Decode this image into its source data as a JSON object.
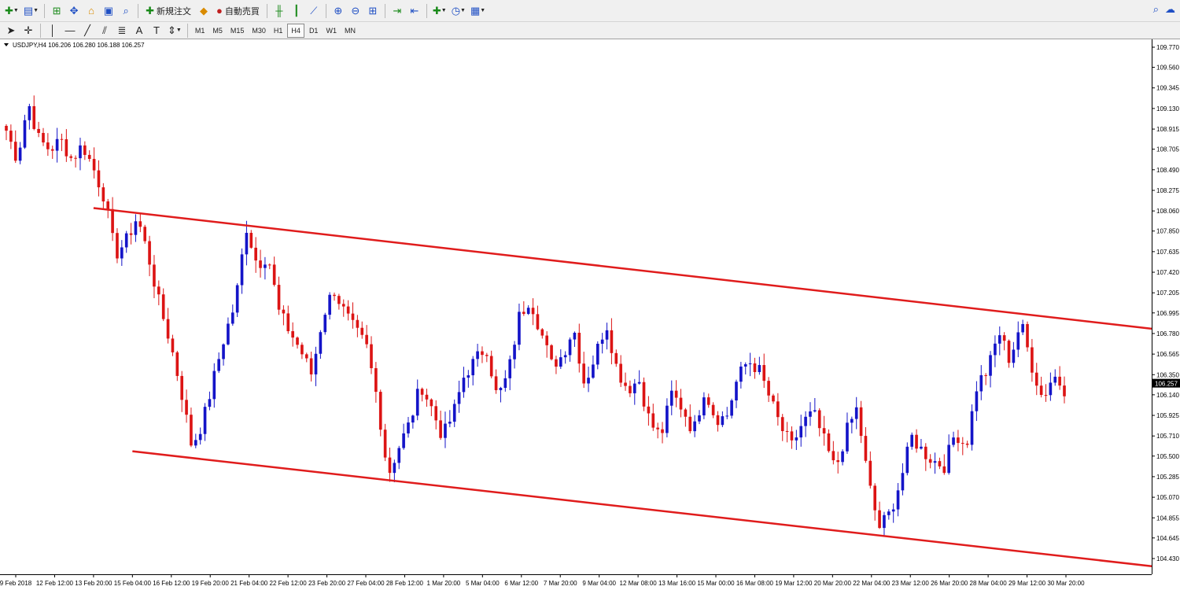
{
  "toolbar": {
    "new_order_label": "新規注文",
    "auto_trading_label": "自動売買",
    "timeframes": [
      "M1",
      "M5",
      "M15",
      "M30",
      "H1",
      "H4",
      "D1",
      "W1",
      "MN"
    ],
    "active_timeframe": "H4"
  },
  "chart_header": "USDJPY,H4  106.206 106.280 106.188 106.257",
  "colors": {
    "bull": "#1414c8",
    "bear": "#dc1414",
    "channel": "#e01c1c",
    "background": "#ffffff"
  },
  "chart_data": {
    "type": "candlestick",
    "symbol": "USDJPY",
    "timeframe": "H4",
    "ylim": [
      104.32,
      109.88
    ],
    "current_price": 106.257,
    "price_ticks": [
      "109.770",
      "109.560",
      "109.345",
      "109.130",
      "108.915",
      "108.705",
      "108.490",
      "108.275",
      "108.060",
      "107.850",
      "107.635",
      "107.420",
      "107.205",
      "106.995",
      "106.780",
      "106.565",
      "106.350",
      "106.140",
      "105.925",
      "105.710",
      "105.500",
      "105.285",
      "105.070",
      "104.855",
      "104.645",
      "104.430"
    ],
    "time_labels": [
      "9 Feb 2018",
      "12 Feb 12:00",
      "13 Feb 20:00",
      "15 Feb 04:00",
      "16 Feb 12:00",
      "19 Feb 20:00",
      "21 Feb 04:00",
      "22 Feb 12:00",
      "23 Feb 20:00",
      "27 Feb 04:00",
      "28 Feb 12:00",
      "1 Mar 20:00",
      "5 Mar 04:00",
      "6 Mar 12:00",
      "7 Mar 20:00",
      "9 Mar 04:00",
      "12 Mar 08:00",
      "13 Mar 16:00",
      "15 Mar 00:00",
      "16 Mar 08:00",
      "19 Mar 12:00",
      "20 Mar 20:00",
      "22 Mar 04:00",
      "23 Mar 12:00",
      "26 Mar 20:00",
      "28 Mar 04:00",
      "29 Mar 12:00",
      "30 Mar 20:00"
    ],
    "path": [
      108.9,
      108.6,
      109.2,
      108.8,
      108.7,
      108.8,
      108.6,
      108.75,
      108.5,
      108.2,
      107.6,
      107.75,
      108.0,
      107.6,
      107.1,
      106.7,
      106.2,
      105.6,
      105.85,
      106.3,
      106.75,
      107.1,
      107.9,
      107.5,
      107.6,
      107.0,
      106.8,
      106.6,
      106.35,
      106.95,
      107.25,
      107.0,
      106.8,
      106.65,
      106.1,
      105.3,
      105.6,
      105.85,
      106.25,
      106.0,
      105.7,
      105.95,
      106.35,
      106.5,
      106.65,
      106.1,
      106.35,
      106.95,
      107.15,
      106.8,
      106.45,
      106.55,
      106.85,
      106.25,
      106.55,
      106.9,
      106.4,
      106.2,
      106.3,
      105.85,
      105.7,
      106.15,
      106.0,
      105.75,
      106.2,
      105.9,
      105.9,
      106.3,
      106.5,
      106.4,
      106.1,
      105.8,
      105.6,
      105.85,
      105.95,
      105.65,
      105.35,
      105.75,
      106.0,
      105.25,
      104.75,
      104.9,
      105.25,
      105.7,
      105.55,
      105.45,
      105.4,
      105.75,
      105.6,
      106.25,
      106.4,
      106.8,
      106.5,
      106.9,
      106.45,
      106.1,
      106.35,
      106.2
    ],
    "channel_lines": [
      {
        "name": "",
        "from": {
          "time": "13 Feb 20:00",
          "price": 108.09
        },
        "to": {
          "time": "30 Mar 20:00",
          "price": 106.83
        }
      },
      {
        "name": "",
        "from": {
          "time": "15 Feb 04:00",
          "price": 105.55
        },
        "to": {
          "time": "30 Mar 20:00",
          "price": 104.35
        }
      }
    ],
    "grid": false
  }
}
